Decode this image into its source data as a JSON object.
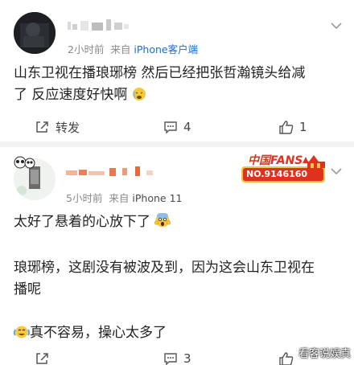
{
  "posts": [
    {
      "meta_time": "2小时前",
      "meta_source_prefix": "来自",
      "meta_source": "iPhone客户端",
      "content_line1": "山东卫视在播琅琊榜 然后已经把张哲瀚镜头给减",
      "content_line2": "了 反应速度好快啊",
      "actions": {
        "repost_label": "转发",
        "comment_count": "4",
        "like_count": "1"
      }
    },
    {
      "meta_time": "5小时前",
      "meta_source_prefix": "来自",
      "meta_source": "iPhone 11",
      "badge_top": "中国FANS",
      "badge_number": "NO.9146160",
      "paragraphs": [
        "太好了悬着的心放下了",
        "琅琊榜，这剧没有被波及到，因为这会山东卫视在",
        "播呢",
        "真不容易，操心太多了"
      ],
      "actions": {
        "comment_count": "3"
      }
    }
  ],
  "watermark": "看客说娱真",
  "colors": {
    "link_blue": "#1c6bd0",
    "badge_red": "#e0301e",
    "badge_gold": "#f6c24a"
  }
}
